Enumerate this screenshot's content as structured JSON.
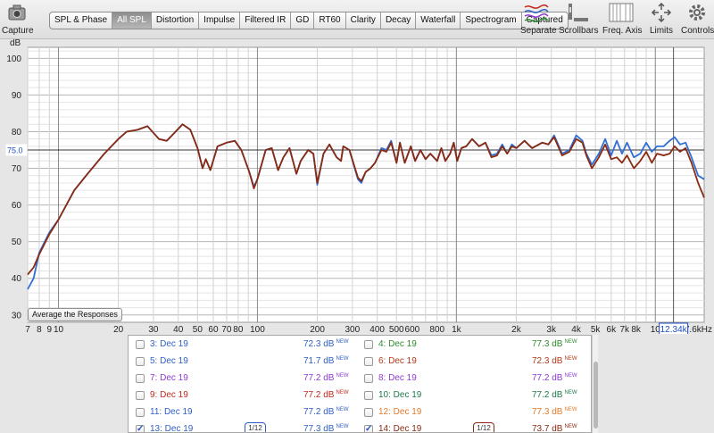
{
  "toolbar": {
    "capture_label": "Capture",
    "tabs": [
      {
        "label": "SPL & Phase",
        "active": false
      },
      {
        "label": "All SPL",
        "active": true
      },
      {
        "label": "Distortion",
        "active": false
      },
      {
        "label": "Impulse",
        "active": false
      },
      {
        "label": "Filtered IR",
        "active": false
      },
      {
        "label": "GD",
        "active": false
      },
      {
        "label": "RT60",
        "active": false
      },
      {
        "label": "Clarity",
        "active": false
      },
      {
        "label": "Decay",
        "active": false
      },
      {
        "label": "Waterfall",
        "active": false
      },
      {
        "label": "Spectrogram",
        "active": false
      },
      {
        "label": "Captured",
        "active": false
      }
    ],
    "right_tools": [
      {
        "label": "Separate",
        "icon": "separate-icon"
      },
      {
        "label": "Scrollbars",
        "icon": "scrollbars-icon"
      },
      {
        "label": "Freq. Axis",
        "icon": "freq-axis-icon"
      },
      {
        "label": "Limits",
        "icon": "limits-icon"
      },
      {
        "label": "Controls",
        "icon": "gear-icon"
      }
    ]
  },
  "chart_data": {
    "type": "line",
    "ylabel": "dB",
    "y_axis": {
      "min": 28,
      "max": 103,
      "ticks": [
        30,
        40,
        50,
        60,
        70,
        80,
        90,
        100
      ]
    },
    "x_axis": {
      "scale": "log",
      "min_hz": 7,
      "max_hz": 17600,
      "tick_labels": [
        {
          "hz": 7,
          "label": "7"
        },
        {
          "hz": 8,
          "label": "8"
        },
        {
          "hz": 9,
          "label": "9"
        },
        {
          "hz": 10,
          "label": "10"
        },
        {
          "hz": 20,
          "label": "20"
        },
        {
          "hz": 30,
          "label": "30"
        },
        {
          "hz": 40,
          "label": "40"
        },
        {
          "hz": 50,
          "label": "50"
        },
        {
          "hz": 60,
          "label": "60"
        },
        {
          "hz": 70,
          "label": "70"
        },
        {
          "hz": 80,
          "label": "80"
        },
        {
          "hz": 100,
          "label": "100"
        },
        {
          "hz": 200,
          "label": "200"
        },
        {
          "hz": 300,
          "label": "300"
        },
        {
          "hz": 400,
          "label": "400"
        },
        {
          "hz": 500,
          "label": "500"
        },
        {
          "hz": 600,
          "label": "600"
        },
        {
          "hz": 800,
          "label": "800"
        },
        {
          "hz": 1000,
          "label": "1k"
        },
        {
          "hz": 2000,
          "label": "2k"
        },
        {
          "hz": 3000,
          "label": "3k"
        },
        {
          "hz": 4000,
          "label": "4k"
        },
        {
          "hz": 5000,
          "label": "5k"
        },
        {
          "hz": 6000,
          "label": "6k"
        },
        {
          "hz": 7000,
          "label": "7k"
        },
        {
          "hz": 8000,
          "label": "8k"
        },
        {
          "hz": 10000,
          "label": "10"
        }
      ],
      "end_label": "17.6kHz"
    },
    "grid": true,
    "cursor": {
      "y_db": 75.0,
      "y_label": "75.0",
      "x_hz": 12340,
      "x_label": "12.34k"
    },
    "series": [
      {
        "name": "13: Dec 19",
        "color": "#2f6fd6",
        "points": [
          [
            7,
            37
          ],
          [
            7.5,
            40
          ],
          [
            8,
            47
          ],
          [
            9,
            52.5
          ],
          [
            10,
            56
          ],
          [
            12,
            64
          ],
          [
            14,
            68.5
          ],
          [
            17,
            74
          ],
          [
            20,
            78
          ],
          [
            22,
            80
          ],
          [
            25,
            80.5
          ],
          [
            28,
            81.5
          ],
          [
            32,
            78
          ],
          [
            35,
            77.5
          ],
          [
            38,
            79.5
          ],
          [
            42,
            82
          ],
          [
            46,
            80.5
          ],
          [
            50,
            75.5
          ],
          [
            53,
            70
          ],
          [
            55,
            72.5
          ],
          [
            58,
            69.5
          ],
          [
            63,
            76
          ],
          [
            70,
            77
          ],
          [
            77,
            77.5
          ],
          [
            83,
            75
          ],
          [
            91,
            69
          ],
          [
            96,
            65
          ],
          [
            100,
            67
          ],
          [
            110,
            75
          ],
          [
            118,
            75.5
          ],
          [
            127,
            69.5
          ],
          [
            135,
            73
          ],
          [
            145,
            75.5
          ],
          [
            157,
            68.5
          ],
          [
            165,
            72
          ],
          [
            180,
            75
          ],
          [
            191,
            74
          ],
          [
            200,
            65.5
          ],
          [
            215,
            74
          ],
          [
            230,
            76.5
          ],
          [
            250,
            73
          ],
          [
            263,
            72
          ],
          [
            270,
            76
          ],
          [
            290,
            75
          ],
          [
            320,
            67
          ],
          [
            333,
            66
          ],
          [
            350,
            69
          ],
          [
            370,
            70
          ],
          [
            390,
            71.5
          ],
          [
            420,
            75.5
          ],
          [
            445,
            75
          ],
          [
            470,
            77.5
          ],
          [
            500,
            71.5
          ],
          [
            520,
            77
          ],
          [
            550,
            71.5
          ],
          [
            590,
            76
          ],
          [
            620,
            72
          ],
          [
            660,
            75
          ],
          [
            700,
            72.5
          ],
          [
            740,
            74
          ],
          [
            800,
            72
          ],
          [
            840,
            75.5
          ],
          [
            880,
            72
          ],
          [
            930,
            74
          ],
          [
            970,
            77
          ],
          [
            1010,
            72
          ],
          [
            1060,
            75.5
          ],
          [
            1120,
            76
          ],
          [
            1200,
            78
          ],
          [
            1300,
            76
          ],
          [
            1400,
            77
          ],
          [
            1500,
            73.5
          ],
          [
            1600,
            74
          ],
          [
            1700,
            76.5
          ],
          [
            1800,
            74
          ],
          [
            1900,
            76.5
          ],
          [
            2000,
            75.5
          ],
          [
            2200,
            77.5
          ],
          [
            2400,
            75.5
          ],
          [
            2700,
            77
          ],
          [
            2900,
            76.5
          ],
          [
            3100,
            79
          ],
          [
            3400,
            74
          ],
          [
            3700,
            75
          ],
          [
            4000,
            79
          ],
          [
            4300,
            77.5
          ],
          [
            4500,
            74
          ],
          [
            4800,
            71
          ],
          [
            5200,
            74
          ],
          [
            5600,
            78
          ],
          [
            6000,
            73.5
          ],
          [
            6400,
            77.5
          ],
          [
            6800,
            74
          ],
          [
            7200,
            77
          ],
          [
            7800,
            73
          ],
          [
            8400,
            74
          ],
          [
            9000,
            77
          ],
          [
            9600,
            74.5
          ],
          [
            10200,
            76
          ],
          [
            11000,
            76
          ],
          [
            11800,
            77.5
          ],
          [
            12500,
            78.5
          ],
          [
            13300,
            76.5
          ],
          [
            14200,
            77
          ],
          [
            15200,
            73
          ],
          [
            16400,
            68
          ],
          [
            17600,
            67
          ]
        ]
      },
      {
        "name": "14: Dec 19",
        "color": "#8a2a10",
        "points": [
          [
            7,
            41
          ],
          [
            7.5,
            43
          ],
          [
            8,
            46.5
          ],
          [
            9,
            52
          ],
          [
            10,
            56
          ],
          [
            12,
            64
          ],
          [
            14,
            68.5
          ],
          [
            17,
            74
          ],
          [
            20,
            78
          ],
          [
            22,
            80
          ],
          [
            25,
            80.5
          ],
          [
            28,
            81.5
          ],
          [
            32,
            78
          ],
          [
            35,
            77.5
          ],
          [
            38,
            79.5
          ],
          [
            42,
            82
          ],
          [
            46,
            80.5
          ],
          [
            50,
            75.5
          ],
          [
            53,
            70
          ],
          [
            55,
            72.5
          ],
          [
            58,
            69.5
          ],
          [
            63,
            76
          ],
          [
            70,
            77
          ],
          [
            77,
            77.5
          ],
          [
            83,
            75
          ],
          [
            91,
            69
          ],
          [
            96,
            64.5
          ],
          [
            100,
            67
          ],
          [
            110,
            75
          ],
          [
            118,
            75.5
          ],
          [
            127,
            69.5
          ],
          [
            135,
            73
          ],
          [
            145,
            75.5
          ],
          [
            157,
            68.5
          ],
          [
            165,
            72
          ],
          [
            180,
            75
          ],
          [
            191,
            74
          ],
          [
            200,
            66
          ],
          [
            215,
            74
          ],
          [
            230,
            76.5
          ],
          [
            250,
            73
          ],
          [
            263,
            72
          ],
          [
            270,
            76
          ],
          [
            290,
            75
          ],
          [
            320,
            67.5
          ],
          [
            333,
            66.5
          ],
          [
            350,
            69
          ],
          [
            370,
            70
          ],
          [
            390,
            71.5
          ],
          [
            420,
            75
          ],
          [
            445,
            74.5
          ],
          [
            470,
            77
          ],
          [
            500,
            71.5
          ],
          [
            520,
            77
          ],
          [
            550,
            71.5
          ],
          [
            590,
            76
          ],
          [
            620,
            72
          ],
          [
            660,
            75
          ],
          [
            700,
            72.5
          ],
          [
            740,
            74
          ],
          [
            800,
            72
          ],
          [
            840,
            75.5
          ],
          [
            880,
            72
          ],
          [
            930,
            74
          ],
          [
            970,
            77
          ],
          [
            1010,
            72
          ],
          [
            1060,
            75.5
          ],
          [
            1120,
            76
          ],
          [
            1200,
            78
          ],
          [
            1300,
            76
          ],
          [
            1400,
            77
          ],
          [
            1500,
            73
          ],
          [
            1600,
            73.5
          ],
          [
            1700,
            76
          ],
          [
            1800,
            74
          ],
          [
            1900,
            76
          ],
          [
            2000,
            75.5
          ],
          [
            2200,
            77.5
          ],
          [
            2400,
            75.5
          ],
          [
            2700,
            77
          ],
          [
            2900,
            76.5
          ],
          [
            3100,
            78.5
          ],
          [
            3400,
            73.5
          ],
          [
            3700,
            74.5
          ],
          [
            4000,
            78
          ],
          [
            4300,
            77
          ],
          [
            4500,
            73.5
          ],
          [
            4800,
            70
          ],
          [
            5200,
            73
          ],
          [
            5600,
            76.5
          ],
          [
            6000,
            72.5
          ],
          [
            6400,
            73
          ],
          [
            6800,
            71.5
          ],
          [
            7200,
            73.5
          ],
          [
            7800,
            70
          ],
          [
            8400,
            72
          ],
          [
            9000,
            74.5
          ],
          [
            9600,
            71.5
          ],
          [
            10200,
            74
          ],
          [
            11000,
            73.5
          ],
          [
            11800,
            74
          ],
          [
            12500,
            76
          ],
          [
            13300,
            74.5
          ],
          [
            14200,
            75.5
          ],
          [
            15200,
            71.5
          ],
          [
            16400,
            66
          ],
          [
            17600,
            62
          ]
        ]
      }
    ]
  },
  "chart": {
    "avg_button": "Average the Responses"
  },
  "list": [
    {
      "left": {
        "label": "3: Dec 19",
        "spl": "72.3 dB",
        "checked": false,
        "color": "#2f5fc4"
      },
      "right": {
        "label": "4: Dec 19",
        "spl": "77.3 dB",
        "checked": false,
        "color": "#2e8b2e"
      }
    },
    {
      "left": {
        "label": "5: Dec 19",
        "spl": "71.7 dB",
        "checked": false,
        "color": "#2f5fc4"
      },
      "right": {
        "label": "6: Dec 19",
        "spl": "72.3 dB",
        "checked": false,
        "color": "#b03a1a"
      }
    },
    {
      "left": {
        "label": "7: Dec 19",
        "spl": "77.2 dB",
        "checked": false,
        "color": "#8e3bd1"
      },
      "right": {
        "label": "8: Dec 19",
        "spl": "77.2 dB",
        "checked": false,
        "color": "#8e3bd1"
      }
    },
    {
      "left": {
        "label": "9: Dec 19",
        "spl": "77.2 dB",
        "checked": false,
        "color": "#c0281e"
      },
      "right": {
        "label": "10: Dec 19",
        "spl": "77.2 dB",
        "checked": false,
        "color": "#1f7a4a"
      }
    },
    {
      "left": {
        "label": "11: Dec 19",
        "spl": "77.2 dB",
        "checked": false,
        "color": "#2f5fc4"
      },
      "right": {
        "label": "12: Dec 19",
        "spl": "77.3 dB",
        "checked": false,
        "color": "#e07a2a"
      }
    },
    {
      "left": {
        "label": "13: Dec 19",
        "spl": "77.3 dB",
        "checked": true,
        "color": "#2f5fc4",
        "smoothing": "1/12"
      },
      "right": {
        "label": "14: Dec 19",
        "spl": "73.7 dB",
        "checked": true,
        "color": "#8a2a10",
        "smoothing": "1/12"
      }
    }
  ],
  "new_badge": "NEW"
}
